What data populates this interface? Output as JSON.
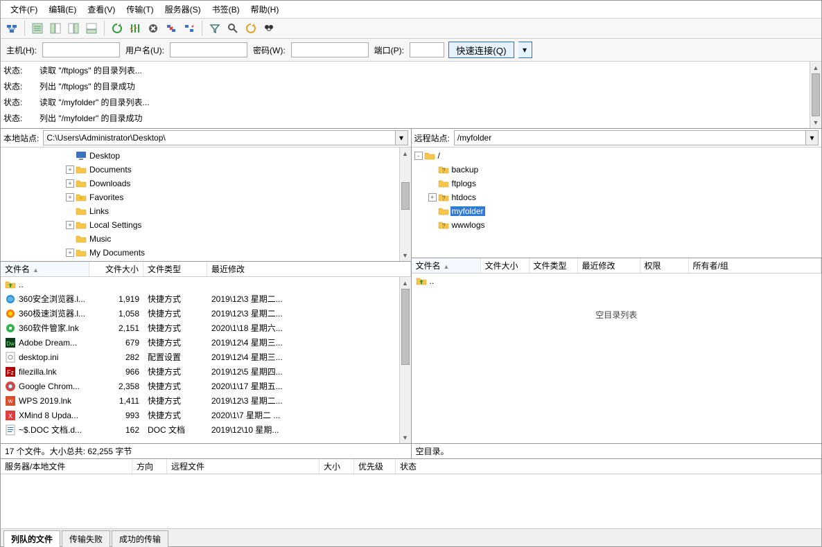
{
  "menu": {
    "file": "文件(F)",
    "edit": "编辑(E)",
    "view": "查看(V)",
    "transfer": "传输(T)",
    "server": "服务器(S)",
    "bookmark": "书签(B)",
    "help": "帮助(H)"
  },
  "qc": {
    "host_lbl": "主机(H):",
    "user_lbl": "用户名(U):",
    "pass_lbl": "密码(W):",
    "port_lbl": "端口(P):",
    "btn": "快速连接(Q)"
  },
  "log": {
    "label": "状态:",
    "lines": [
      "读取 \"/ftplogs\" 的目录列表...",
      "列出 \"/ftplogs\" 的目录成功",
      "读取 \"/myfolder\" 的目录列表...",
      "列出 \"/myfolder\" 的目录成功"
    ]
  },
  "local": {
    "site_lbl": "本地站点:",
    "path": "C:\\Users\\Administrator\\Desktop\\",
    "tree": [
      {
        "indent": 90,
        "toggle": "",
        "icon": "desktop",
        "label": "Desktop"
      },
      {
        "indent": 90,
        "toggle": "+",
        "icon": "folder",
        "label": "Documents"
      },
      {
        "indent": 90,
        "toggle": "+",
        "icon": "folder",
        "label": "Downloads"
      },
      {
        "indent": 90,
        "toggle": "+",
        "icon": "fav",
        "label": "Favorites"
      },
      {
        "indent": 90,
        "toggle": "",
        "icon": "folder",
        "label": "Links"
      },
      {
        "indent": 90,
        "toggle": "+",
        "icon": "folder",
        "label": "Local Settings"
      },
      {
        "indent": 90,
        "toggle": "",
        "icon": "folder",
        "label": "Music"
      },
      {
        "indent": 90,
        "toggle": "+",
        "icon": "folder",
        "label": "My Documents"
      }
    ],
    "cols": {
      "name": "文件名",
      "size": "文件大小",
      "type": "文件类型",
      "mod": "最近修改"
    },
    "files": [
      {
        "icon": "up",
        "name": "..",
        "size": "",
        "type": "",
        "mod": ""
      },
      {
        "icon": "ie",
        "name": "360安全浏览器.l...",
        "size": "1,919",
        "type": "快捷方式",
        "mod": "2019\\12\\3 星期二..."
      },
      {
        "icon": "360s",
        "name": "360极速浏览器.l...",
        "size": "1,058",
        "type": "快捷方式",
        "mod": "2019\\12\\3 星期二..."
      },
      {
        "icon": "360m",
        "name": "360软件管家.lnk",
        "size": "2,151",
        "type": "快捷方式",
        "mod": "2020\\1\\18 星期六..."
      },
      {
        "icon": "dw",
        "name": "Adobe Dream...",
        "size": "679",
        "type": "快捷方式",
        "mod": "2019\\12\\4 星期三..."
      },
      {
        "icon": "ini",
        "name": "desktop.ini",
        "size": "282",
        "type": "配置设置",
        "mod": "2019\\12\\4 星期三..."
      },
      {
        "icon": "fz",
        "name": "filezilla.lnk",
        "size": "966",
        "type": "快捷方式",
        "mod": "2019\\12\\5 星期四..."
      },
      {
        "icon": "gc",
        "name": "Google Chrom...",
        "size": "2,358",
        "type": "快捷方式",
        "mod": "2020\\1\\17 星期五..."
      },
      {
        "icon": "wps",
        "name": "WPS 2019.lnk",
        "size": "1,411",
        "type": "快捷方式",
        "mod": "2019\\12\\3 星期二..."
      },
      {
        "icon": "xm",
        "name": "XMind 8 Upda...",
        "size": "993",
        "type": "快捷方式",
        "mod": "2020\\1\\7 星期二 ..."
      },
      {
        "icon": "doc",
        "name": "~$.DOC 文档.d...",
        "size": "162",
        "type": "DOC 文档",
        "mod": "2019\\12\\10 星期..."
      }
    ],
    "status": "17 个文件。大小总共: 62,255 字节"
  },
  "remote": {
    "site_lbl": "远程站点:",
    "path": "/myfolder",
    "tree": [
      {
        "indent": 0,
        "toggle": "-",
        "icon": "folder",
        "label": "/",
        "sel": false
      },
      {
        "indent": 20,
        "toggle": "",
        "icon": "folderq",
        "label": "backup"
      },
      {
        "indent": 20,
        "toggle": "",
        "icon": "folder",
        "label": "ftplogs"
      },
      {
        "indent": 20,
        "toggle": "+",
        "icon": "folderq",
        "label": "htdocs"
      },
      {
        "indent": 20,
        "toggle": "",
        "icon": "folder",
        "label": "myfolder",
        "sel": true
      },
      {
        "indent": 20,
        "toggle": "",
        "icon": "folderq",
        "label": "wwwlogs"
      }
    ],
    "cols": {
      "name": "文件名",
      "size": "文件大小",
      "type": "文件类型",
      "mod": "最近修改",
      "perm": "权限",
      "owner": "所有者/组"
    },
    "files": [
      {
        "icon": "up",
        "name": ".."
      }
    ],
    "empty": "空目录列表",
    "status": "空目录。"
  },
  "queue": {
    "cols": {
      "srv": "服务器/本地文件",
      "dir": "方向",
      "remote": "远程文件",
      "size": "大小",
      "prio": "优先级",
      "state": "状态"
    }
  },
  "tabs": {
    "queued": "列队的文件",
    "failed": "传输失败",
    "ok": "成功的传输"
  }
}
